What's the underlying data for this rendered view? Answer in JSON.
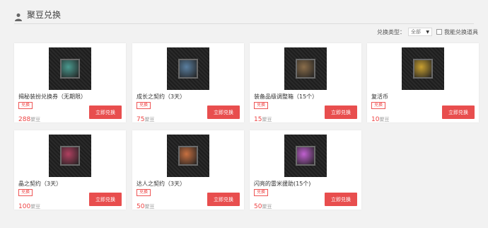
{
  "header": {
    "title": "聚豆兑换"
  },
  "filter": {
    "type_label": "兑换类型：",
    "type_value": "全部",
    "checkbox_label": "我能兑换道具"
  },
  "badge_label": "兑换",
  "button_label": "立即兑换",
  "currency": "聚豆",
  "items": [
    {
      "name": "揭秘装扮兑换券（无期限）",
      "price": "288",
      "color": "#4a9a8f"
    },
    {
      "name": "成长之契约（3天）",
      "price": "75",
      "color": "#5a7fa0"
    },
    {
      "name": "装备品级调整箱（15个）",
      "price": "15",
      "color": "#8a6d4a"
    },
    {
      "name": "复活币",
      "price": "10",
      "color": "#c9a030"
    },
    {
      "name": "晶之契约（3天）",
      "price": "100",
      "color": "#b04060"
    },
    {
      "name": "达人之契约（3天）",
      "price": "50",
      "color": "#c87040"
    },
    {
      "name": "闪亮的雷米援助(15个)",
      "price": "50",
      "color": "#c060d0"
    }
  ]
}
